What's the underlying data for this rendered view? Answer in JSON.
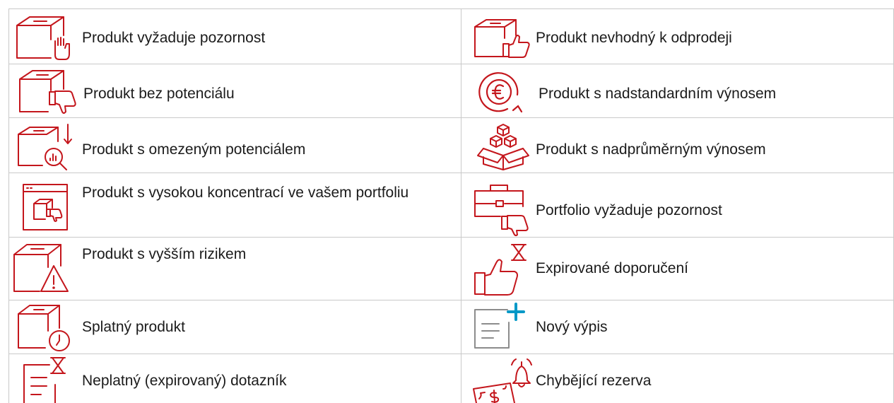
{
  "legend": {
    "rows": [
      {
        "left": {
          "icon": "product-box-hand-stop-icon",
          "label": "Produkt vyžaduje pozornost"
        },
        "right": {
          "icon": "product-box-thumbs-up-icon",
          "label": "Produkt nevhodný k odprodeji"
        }
      },
      {
        "left": {
          "icon": "product-box-thumbs-down-icon",
          "label": "Produkt bez potenciálu"
        },
        "right": {
          "icon": "euro-coin-circular-arrow-icon",
          "label": "Produkt s nadstandardním výnosem"
        }
      },
      {
        "left": {
          "icon": "product-box-magnifier-arrow-down-icon",
          "label": "Produkt s omezeným potenciálem"
        },
        "right": {
          "icon": "stacked-boxes-open-box-icon",
          "label": "Produkt s nadprůměrným výnosem"
        }
      },
      {
        "left": {
          "icon": "browser-window-box-thumbs-down-icon",
          "label": "Produkt s vysokou koncentrací ve vašem portfoliu"
        },
        "right": {
          "icon": "briefcase-thumbs-down-icon",
          "label": "Portfolio vyžaduje pozornost"
        }
      },
      {
        "left": {
          "icon": "product-box-warning-icon",
          "label": "Produkt s vyšším rizikem"
        },
        "right": {
          "icon": "thumbs-up-hourglass-icon",
          "label": "Expirované doporučení"
        }
      },
      {
        "left": {
          "icon": "product-box-clock-icon",
          "label": "Splatný produkt"
        },
        "right": {
          "icon": "document-plus-icon",
          "label": "Nový výpis"
        }
      },
      {
        "left": {
          "icon": "document-hourglass-icon",
          "label": "Neplatný (expirovaný) dotazník"
        },
        "right": {
          "icon": "banknote-bell-icon",
          "label": "Chybějící rezerva"
        }
      }
    ]
  },
  "colors": {
    "icon_red": "#c4161c",
    "plus_blue": "#0098c7",
    "doc_gray": "#8c8c8c",
    "grid": "#c9c9c9"
  }
}
